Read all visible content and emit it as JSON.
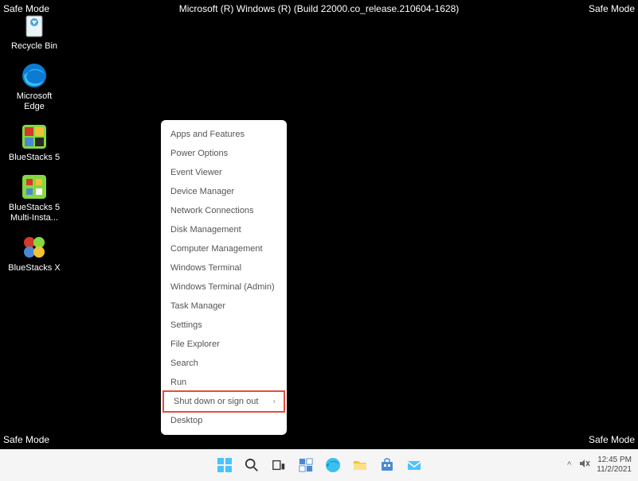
{
  "safe_mode_label": "Safe Mode",
  "build_info": "Microsoft (R) Windows (R) (Build 22000.co_release.210604-1628)",
  "desktop_icons": [
    {
      "name": "recycle-bin",
      "label": "Recycle Bin"
    },
    {
      "name": "microsoft-edge",
      "label": "Microsoft Edge"
    },
    {
      "name": "bluestacks-5",
      "label": "BlueStacks 5"
    },
    {
      "name": "bluestacks-5-multi",
      "label": "BlueStacks 5 Multi-Insta..."
    },
    {
      "name": "bluestacks-x",
      "label": "BlueStacks X"
    }
  ],
  "context_menu": {
    "items": [
      {
        "label": "Apps and Features",
        "highlighted": false
      },
      {
        "label": "Power Options",
        "highlighted": false
      },
      {
        "label": "Event Viewer",
        "highlighted": false
      },
      {
        "label": "Device Manager",
        "highlighted": false
      },
      {
        "label": "Network Connections",
        "highlighted": false
      },
      {
        "label": "Disk Management",
        "highlighted": false
      },
      {
        "label": "Computer Management",
        "highlighted": false
      },
      {
        "label": "Windows Terminal",
        "highlighted": false
      },
      {
        "label": "Windows Terminal (Admin)",
        "highlighted": false
      },
      {
        "label": "Task Manager",
        "highlighted": false
      },
      {
        "label": "Settings",
        "highlighted": false
      },
      {
        "label": "File Explorer",
        "highlighted": false
      },
      {
        "label": "Search",
        "highlighted": false
      },
      {
        "label": "Run",
        "highlighted": false
      },
      {
        "label": "Shut down or sign out",
        "highlighted": true,
        "has_submenu": true
      },
      {
        "label": "Desktop",
        "highlighted": false
      }
    ]
  },
  "taskbar": {
    "time": "12:45 PM",
    "date": "11/2/2021"
  }
}
